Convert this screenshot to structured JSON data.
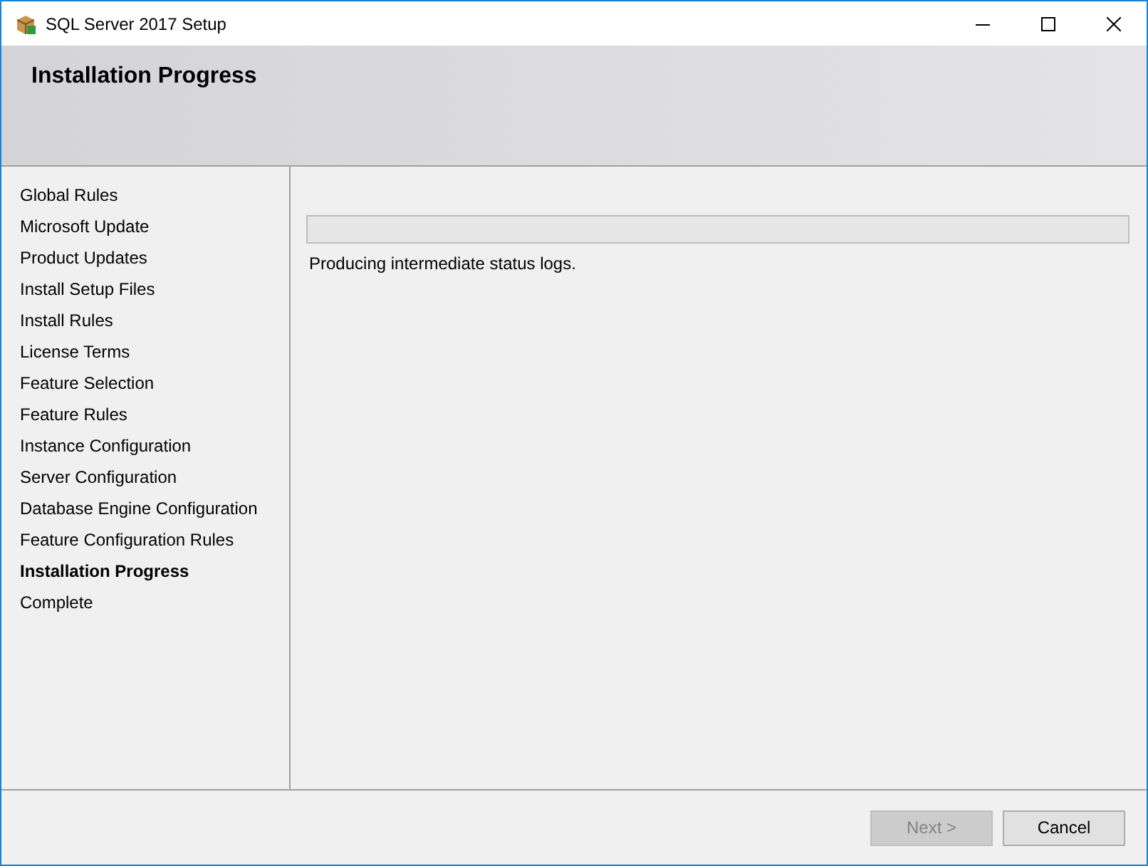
{
  "window": {
    "title": "SQL Server 2017 Setup"
  },
  "header": {
    "title": "Installation Progress"
  },
  "steps": [
    {
      "label": "Global Rules",
      "selected": false
    },
    {
      "label": "Microsoft Update",
      "selected": false
    },
    {
      "label": "Product Updates",
      "selected": false
    },
    {
      "label": "Install Setup Files",
      "selected": false
    },
    {
      "label": "Install Rules",
      "selected": false
    },
    {
      "label": "License Terms",
      "selected": false
    },
    {
      "label": "Feature Selection",
      "selected": false
    },
    {
      "label": "Feature Rules",
      "selected": false
    },
    {
      "label": "Instance Configuration",
      "selected": false
    },
    {
      "label": "Server Configuration",
      "selected": false
    },
    {
      "label": "Database Engine Configuration",
      "selected": false
    },
    {
      "label": "Feature Configuration Rules",
      "selected": false
    },
    {
      "label": "Installation Progress",
      "selected": true
    },
    {
      "label": "Complete",
      "selected": false
    }
  ],
  "progress": {
    "level": 0,
    "status": "Producing intermediate status logs."
  },
  "buttons": [
    {
      "label": "Next >",
      "disabled": true
    },
    {
      "label": "Cancel",
      "disabled": false
    }
  ]
}
